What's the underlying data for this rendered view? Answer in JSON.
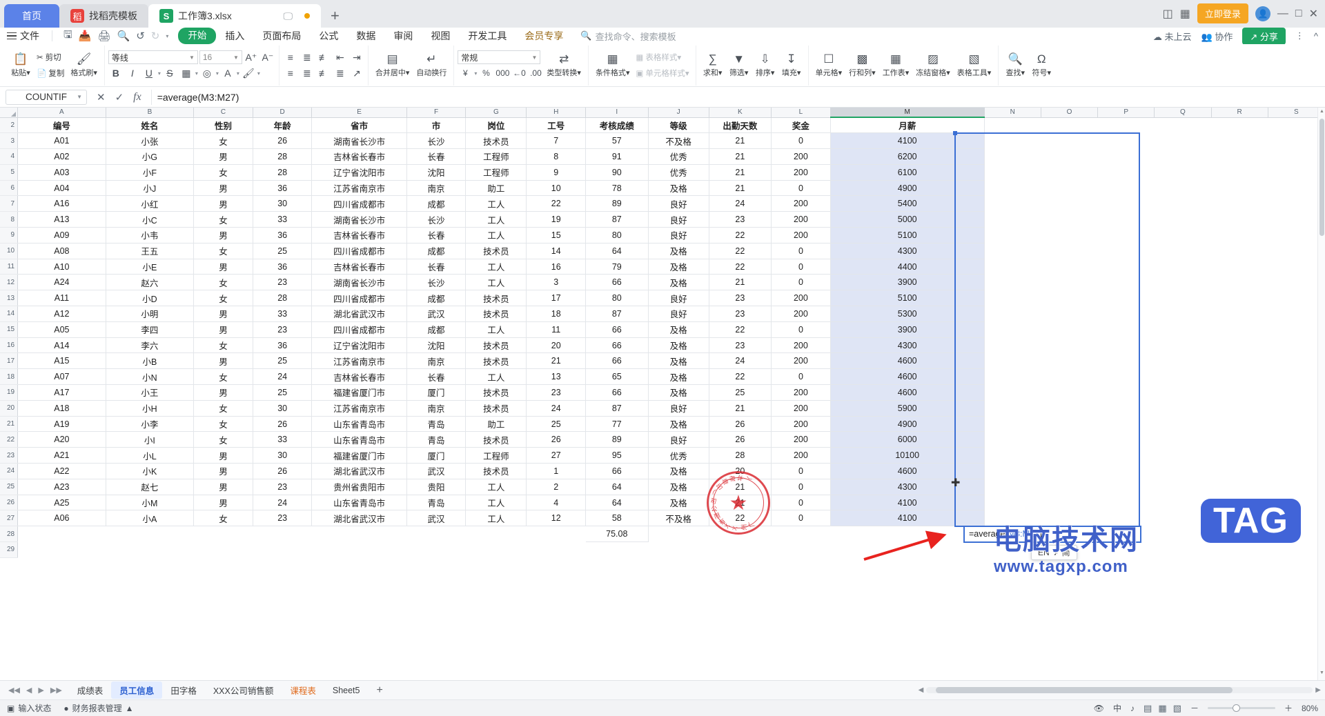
{
  "window": {
    "tabs": [
      {
        "label": "首页",
        "kind": "home"
      },
      {
        "label": "找稻壳模板",
        "kind": "template",
        "badge": "稻"
      },
      {
        "label": "工作簿3.xlsx",
        "kind": "doc",
        "icon": "S"
      }
    ],
    "new_tab_label": "+",
    "login_label": "立即登录",
    "minimize": "—",
    "maximize": "□",
    "close": "✕",
    "restore_icon": "⧉",
    "grid_icon": "▦"
  },
  "menu": {
    "file_label": "文件",
    "quick_access": [
      "save-icon",
      "save-as-icon",
      "print-icon",
      "print-preview-icon",
      "undo-icon",
      "redo-icon",
      "more-icon"
    ],
    "tabs": [
      "开始",
      "插入",
      "页面布局",
      "公式",
      "数据",
      "审阅",
      "视图",
      "开发工具",
      "会员专享"
    ],
    "active_tab": "开始",
    "search_placeholder": "查找命令、搜索模板",
    "right": [
      "未上云",
      "协作"
    ],
    "share_label": "分享"
  },
  "ribbon": {
    "clipboard": {
      "paste": "粘贴",
      "cut": "剪切",
      "copy": "复制",
      "format_painter": "格式刷"
    },
    "font": {
      "family": "等线",
      "size": "16",
      "grow": "A⁺",
      "shrink": "A⁻",
      "bold": "B",
      "italic": "I",
      "underline": "U",
      "strike": "S",
      "border": "borders-icon",
      "effects": "text-effects-icon",
      "fontcolor": "A",
      "fillcolor": "fill-icon"
    },
    "align": {
      "merge": "合并居中",
      "wrap": "自动换行"
    },
    "number": {
      "format": "常规",
      "currency": "¥",
      "percent": "%",
      "comma": "000",
      "inc_dec": "←0",
      "dec_dec": ".00",
      "convert": "类型转换"
    },
    "styles": {
      "conditional": "条件格式",
      "table_style": "表格样式",
      "cell_style": "单元格样式"
    },
    "editing": {
      "sum": "求和",
      "filter": "筛选",
      "sort": "排序",
      "fill": "填充"
    },
    "cells": {
      "cell": "单元格",
      "rows_cols": "行和列",
      "worksheet": "工作表",
      "freeze": "冻结窗格",
      "table_tools": "表格工具"
    },
    "find": {
      "find": "查找",
      "symbol": "符号"
    }
  },
  "formula_bar": {
    "name_box": "COUNTIF",
    "cancel": "✕",
    "accept": "✓",
    "fx": "fx",
    "value": "=average(M3:M27)"
  },
  "grid": {
    "columns": [
      "A",
      "B",
      "C",
      "D",
      "E",
      "F",
      "G",
      "H",
      "I",
      "J",
      "K",
      "L",
      "M",
      "N",
      "O",
      "P",
      "Q",
      "R",
      "S"
    ],
    "selected_column": "M",
    "widths": [
      152,
      152,
      100,
      100,
      152,
      100,
      100,
      100,
      100,
      100,
      100,
      100,
      268,
      100,
      100,
      100,
      100,
      100,
      100
    ],
    "row_numbers": [
      "2",
      "3",
      "4",
      "5",
      "6",
      "7",
      "8",
      "9",
      "10",
      "11",
      "12",
      "13",
      "14",
      "15",
      "16",
      "17",
      "18",
      "19",
      "20",
      "21",
      "22",
      "23",
      "24",
      "25",
      "26",
      "27",
      "28",
      "29"
    ],
    "header_row": [
      "编号",
      "姓名",
      "性别",
      "年龄",
      "省市",
      "市",
      "岗位",
      "工号",
      "考核成绩",
      "等级",
      "出勤天数",
      "奖金",
      "月薪"
    ],
    "rows": [
      [
        "A01",
        "小张",
        "女",
        "26",
        "湖南省长沙市",
        "长沙",
        "技术员",
        "7",
        "57",
        "不及格",
        "21",
        "0",
        "4100"
      ],
      [
        "A02",
        "小G",
        "男",
        "28",
        "吉林省长春市",
        "长春",
        "工程师",
        "8",
        "91",
        "优秀",
        "21",
        "200",
        "6200"
      ],
      [
        "A03",
        "小F",
        "女",
        "28",
        "辽宁省沈阳市",
        "沈阳",
        "工程师",
        "9",
        "90",
        "优秀",
        "21",
        "200",
        "6100"
      ],
      [
        "A04",
        "小J",
        "男",
        "36",
        "江苏省南京市",
        "南京",
        "助工",
        "10",
        "78",
        "及格",
        "21",
        "0",
        "4900"
      ],
      [
        "A16",
        "小红",
        "男",
        "30",
        "四川省成都市",
        "成都",
        "工人",
        "22",
        "89",
        "良好",
        "24",
        "200",
        "5400"
      ],
      [
        "A13",
        "小C",
        "女",
        "33",
        "湖南省长沙市",
        "长沙",
        "工人",
        "19",
        "87",
        "良好",
        "23",
        "200",
        "5000"
      ],
      [
        "A09",
        "小韦",
        "男",
        "36",
        "吉林省长春市",
        "长春",
        "工人",
        "15",
        "80",
        "良好",
        "22",
        "200",
        "5100"
      ],
      [
        "A08",
        "王五",
        "女",
        "25",
        "四川省成都市",
        "成都",
        "技术员",
        "14",
        "64",
        "及格",
        "22",
        "0",
        "4300"
      ],
      [
        "A10",
        "小E",
        "男",
        "36",
        "吉林省长春市",
        "长春",
        "工人",
        "16",
        "79",
        "及格",
        "22",
        "0",
        "4400"
      ],
      [
        "A24",
        "赵六",
        "女",
        "23",
        "湖南省长沙市",
        "长沙",
        "工人",
        "3",
        "66",
        "及格",
        "21",
        "0",
        "3900"
      ],
      [
        "A11",
        "小D",
        "女",
        "28",
        "四川省成都市",
        "成都",
        "技术员",
        "17",
        "80",
        "良好",
        "23",
        "200",
        "5100"
      ],
      [
        "A12",
        "小明",
        "男",
        "33",
        "湖北省武汉市",
        "武汉",
        "技术员",
        "18",
        "87",
        "良好",
        "23",
        "200",
        "5300"
      ],
      [
        "A05",
        "李四",
        "男",
        "23",
        "四川省成都市",
        "成都",
        "工人",
        "11",
        "66",
        "及格",
        "22",
        "0",
        "3900"
      ],
      [
        "A14",
        "李六",
        "女",
        "36",
        "辽宁省沈阳市",
        "沈阳",
        "技术员",
        "20",
        "66",
        "及格",
        "23",
        "200",
        "4300"
      ],
      [
        "A15",
        "小B",
        "男",
        "25",
        "江苏省南京市",
        "南京",
        "技术员",
        "21",
        "66",
        "及格",
        "24",
        "200",
        "4600"
      ],
      [
        "A07",
        "小N",
        "女",
        "24",
        "吉林省长春市",
        "长春",
        "工人",
        "13",
        "65",
        "及格",
        "22",
        "0",
        "4600"
      ],
      [
        "A17",
        "小王",
        "男",
        "25",
        "福建省厦门市",
        "厦门",
        "技术员",
        "23",
        "66",
        "及格",
        "25",
        "200",
        "4600"
      ],
      [
        "A18",
        "小H",
        "女",
        "30",
        "江苏省南京市",
        "南京",
        "技术员",
        "24",
        "87",
        "良好",
        "21",
        "200",
        "5900"
      ],
      [
        "A19",
        "小李",
        "女",
        "26",
        "山东省青岛市",
        "青岛",
        "助工",
        "25",
        "77",
        "及格",
        "26",
        "200",
        "4900"
      ],
      [
        "A20",
        "小I",
        "女",
        "33",
        "山东省青岛市",
        "青岛",
        "技术员",
        "26",
        "89",
        "良好",
        "26",
        "200",
        "6000"
      ],
      [
        "A21",
        "小L",
        "男",
        "30",
        "福建省厦门市",
        "厦门",
        "工程师",
        "27",
        "95",
        "优秀",
        "28",
        "200",
        "10100"
      ],
      [
        "A22",
        "小K",
        "男",
        "26",
        "湖北省武汉市",
        "武汉",
        "技术员",
        "1",
        "66",
        "及格",
        "20",
        "0",
        "4600"
      ],
      [
        "A23",
        "赵七",
        "男",
        "23",
        "贵州省贵阳市",
        "贵阳",
        "工人",
        "2",
        "64",
        "及格",
        "21",
        "0",
        "4300"
      ],
      [
        "A25",
        "小M",
        "男",
        "24",
        "山东省青岛市",
        "青岛",
        "工人",
        "4",
        "64",
        "及格",
        "21",
        "0",
        "4100"
      ],
      [
        "A06",
        "小A",
        "女",
        "23",
        "湖北省武汉市",
        "武汉",
        "工人",
        "12",
        "58",
        "不及格",
        "22",
        "0",
        "4100"
      ]
    ],
    "summary_row": {
      "row": "28",
      "i_value": "75.08"
    },
    "edit_cell": {
      "prefix": "=average(",
      "args": "M3:M27",
      "suffix": ""
    },
    "ime": {
      "lang": "EN",
      "mode_icon": "♪",
      "label": "简"
    },
    "stamp_text": "广州XX有限公司(印章样本)",
    "watermark": {
      "main": "电脑技术网",
      "sub": "www.tagxp.com",
      "tag": "TAG"
    }
  },
  "sheet_tabs": {
    "items": [
      {
        "label": "成绩表",
        "state": "normal"
      },
      {
        "label": "员工信息",
        "state": "active"
      },
      {
        "label": "田字格",
        "state": "normal"
      },
      {
        "label": "XXX公司销售额",
        "state": "normal"
      },
      {
        "label": "课程表",
        "state": "orange"
      },
      {
        "label": "Sheet5",
        "state": "normal"
      }
    ],
    "add_label": "+"
  },
  "status_bar": {
    "input_state": "输入状态",
    "report_mgmt": "财务报表管理",
    "ime_lang": "中",
    "zoom": "80%",
    "zoom_minus": "－",
    "zoom_plus": "＋"
  }
}
